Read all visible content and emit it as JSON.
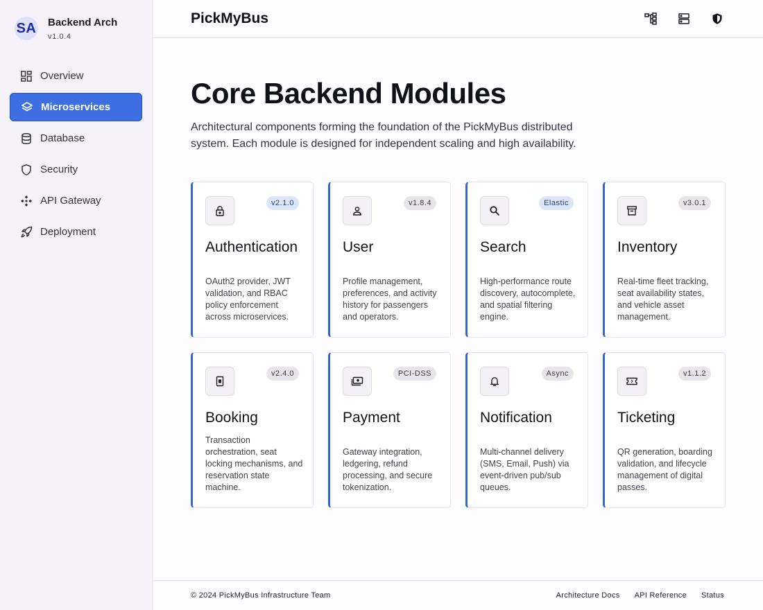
{
  "brand": {
    "initials": "SA",
    "title": "Backend Arch",
    "version": "v1.0.4"
  },
  "nav": [
    {
      "label": "Overview",
      "icon": "dashboard-icon",
      "active": false
    },
    {
      "label": "Microservices",
      "icon": "layers-icon",
      "active": true
    },
    {
      "label": "Database",
      "icon": "database-icon",
      "active": false
    },
    {
      "label": "Security",
      "icon": "shield-icon",
      "active": false
    },
    {
      "label": "API Gateway",
      "icon": "api-gateway-icon",
      "active": false
    },
    {
      "label": "Deployment",
      "icon": "rocket-icon",
      "active": false
    }
  ],
  "header": {
    "title": "PickMyBus",
    "icons": [
      "hierarchy-icon",
      "server-icon",
      "shield-filled-icon"
    ]
  },
  "main": {
    "heading": "Core Backend Modules",
    "intro": "Architectural components forming the foundation of the PickMyBus distributed system. Each module is designed for independent scaling and high availability."
  },
  "modules": [
    {
      "title": "Authentication",
      "badge": "v2.1.0",
      "badge_style": "blue",
      "icon": "lock-icon",
      "desc": "OAuth2 provider, JWT validation, and RBAC policy enforcement across microservices."
    },
    {
      "title": "User",
      "badge": "v1.8.4",
      "badge_style": "gray",
      "icon": "user-icon",
      "desc": "Profile management, preferences, and activity history for passengers and operators."
    },
    {
      "title": "Search",
      "badge": "Elastic",
      "badge_style": "blue",
      "icon": "search-icon",
      "desc": "High-performance route discovery, autocomplete, and spatial filtering engine."
    },
    {
      "title": "Inventory",
      "badge": "v3.0.1",
      "badge_style": "gray",
      "icon": "archive-icon",
      "desc": "Real-time fleet tracking, seat availability states, and vehicle asset management."
    },
    {
      "title": "Booking",
      "badge": "v2.4.0",
      "badge_style": "gray",
      "icon": "booking-icon",
      "desc": "Transaction orchestration, seat locking mechanisms, and reservation state machine."
    },
    {
      "title": "Payment",
      "badge": "PCI-DSS",
      "badge_style": "gray",
      "icon": "payments-icon",
      "desc": "Gateway integration, ledgering, refund processing, and secure tokenization."
    },
    {
      "title": "Notification",
      "badge": "Async",
      "badge_style": "gray",
      "icon": "bell-icon",
      "desc": "Multi-channel delivery (SMS, Email, Push) via event-driven pub/sub queues."
    },
    {
      "title": "Ticketing",
      "badge": "v1.1.2",
      "badge_style": "gray",
      "icon": "ticket-icon",
      "desc": "QR generation, boarding validation, and lifecycle management of digital passes."
    }
  ],
  "footer": {
    "copyright": "© 2024 PickMyBus Infrastructure Team",
    "links": [
      "Architecture Docs",
      "API Reference",
      "Status"
    ]
  },
  "colors": {
    "accent": "#3d6fe3",
    "card_border_accent": "#3266d6",
    "badge_blue": "#dce6fb"
  }
}
